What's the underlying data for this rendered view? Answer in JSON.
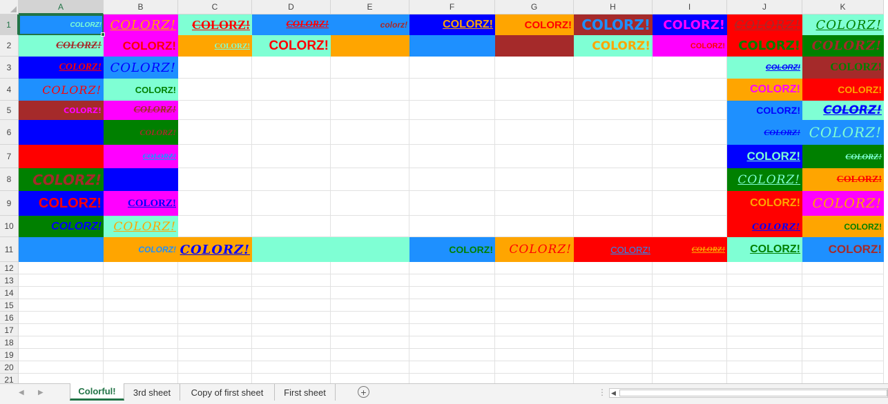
{
  "spreadsheet": {
    "columns": [
      "A",
      "B",
      "C",
      "D",
      "E",
      "F",
      "G",
      "H",
      "I",
      "J",
      "K"
    ],
    "rows": [
      "1",
      "2",
      "3",
      "4",
      "5",
      "6",
      "7",
      "8",
      "9",
      "10",
      "11",
      "12",
      "13",
      "14",
      "15",
      "16",
      "17",
      "18",
      "19",
      "20",
      "21"
    ],
    "selected_cell": "A1",
    "colors": {
      "blue": "#1E90FF",
      "magenta": "#FF00FF",
      "aquamarine": "#7FFFD4",
      "navy": "#0000FF",
      "orange": "#FFA500",
      "brown": "#A52A2A",
      "red": "#FF0000",
      "green": "#008000",
      "header_bg": "#EFEFEF",
      "accent": "#217346",
      "gridline": "#E1E1E1"
    },
    "cells": [
      {
        "ref": "A1",
        "bg": "blue",
        "text": "COLORZ!",
        "color": "aquamarine",
        "font": "arial",
        "size": 10,
        "bold": true,
        "italic": true,
        "under": false,
        "strike": false
      },
      {
        "ref": "B1",
        "bg": "magenta",
        "text": "COLORZ!",
        "color": "orange",
        "font": "script",
        "size": 18,
        "bold": false,
        "italic": true,
        "under": true,
        "strike": false
      },
      {
        "ref": "C1",
        "bg": "aquamarine",
        "text": "COLORZ!",
        "color": "red",
        "font": "serif",
        "size": 18,
        "bold": true,
        "italic": false,
        "under": true,
        "strike": true
      },
      {
        "ref": "D1",
        "bg": "blue",
        "text": "COLORZ!",
        "color": "red",
        "font": "serif",
        "size": 14,
        "bold": true,
        "italic": true,
        "under": true,
        "strike": true
      },
      {
        "ref": "E1",
        "bg": "blue",
        "text": "colorz!",
        "color": "brown",
        "font": "arial",
        "size": 12,
        "bold": true,
        "italic": true,
        "under": false,
        "strike": false
      },
      {
        "ref": "F1",
        "bg": "navy",
        "text": "COLORZ!",
        "color": "orange",
        "font": "arial",
        "size": 16,
        "bold": true,
        "italic": false,
        "under": true,
        "strike": false
      },
      {
        "ref": "G1",
        "bg": "orange",
        "text": "COLORZ!",
        "color": "red",
        "font": "arial",
        "size": 15,
        "bold": true,
        "italic": false,
        "under": false,
        "strike": false
      },
      {
        "ref": "H1",
        "bg": "brown",
        "text": "COLORZ!",
        "color": "blue",
        "font": "impact",
        "size": 20,
        "bold": true,
        "italic": false,
        "under": false,
        "strike": false
      },
      {
        "ref": "I1",
        "bg": "navy",
        "text": "COLORZ!",
        "color": "magenta",
        "font": "impact",
        "size": 18,
        "bold": true,
        "italic": false,
        "under": false,
        "strike": false
      },
      {
        "ref": "J1",
        "bg": "red",
        "text": "COLORZ!",
        "color": "brown",
        "font": "script",
        "size": 18,
        "bold": false,
        "italic": true,
        "under": true,
        "strike": true
      },
      {
        "ref": "K1",
        "bg": "aquamarine",
        "text": "COLORZ!",
        "color": "green",
        "font": "script",
        "size": 18,
        "bold": false,
        "italic": true,
        "under": true,
        "strike": false
      },
      {
        "ref": "A2",
        "bg": "aquamarine",
        "text": "COLORZ!",
        "color": "brown",
        "font": "serif",
        "size": 15,
        "bold": true,
        "italic": true,
        "under": false,
        "strike": true
      },
      {
        "ref": "B2",
        "bg": "magenta",
        "text": "COLORZ!",
        "color": "red",
        "font": "arial",
        "size": 17,
        "bold": true,
        "italic": false,
        "under": false,
        "strike": false
      },
      {
        "ref": "C2",
        "bg": "orange",
        "text": "COLORZ!",
        "color": "aquamarine",
        "font": "serif",
        "size": 11,
        "bold": true,
        "italic": false,
        "under": true,
        "strike": false
      },
      {
        "ref": "D2",
        "bg": "aquamarine",
        "text": "COLORZ!",
        "color": "red",
        "font": "arial",
        "size": 19,
        "bold": true,
        "italic": false,
        "under": false,
        "strike": false
      },
      {
        "ref": "E2",
        "bg": "orange",
        "text": "",
        "color": "",
        "font": "arial",
        "size": 12,
        "bold": false,
        "italic": false,
        "under": false,
        "strike": false
      },
      {
        "ref": "F2",
        "bg": "blue",
        "text": "",
        "color": "",
        "font": "arial",
        "size": 12,
        "bold": false,
        "italic": false,
        "under": false,
        "strike": false
      },
      {
        "ref": "G2",
        "bg": "brown",
        "text": "",
        "color": "",
        "font": "arial",
        "size": 12,
        "bold": false,
        "italic": false,
        "under": false,
        "strike": false
      },
      {
        "ref": "H2",
        "bg": "aquamarine",
        "text": "COLORZ!",
        "color": "orange",
        "font": "impact",
        "size": 17,
        "bold": true,
        "italic": false,
        "under": false,
        "strike": false
      },
      {
        "ref": "I2",
        "bg": "magenta",
        "text": "COLORZ!",
        "color": "red",
        "font": "arial",
        "size": 11,
        "bold": true,
        "italic": false,
        "under": false,
        "strike": false
      },
      {
        "ref": "J2",
        "bg": "red",
        "text": "COLORZ!",
        "color": "green",
        "font": "impact",
        "size": 18,
        "bold": true,
        "italic": false,
        "under": false,
        "strike": false
      },
      {
        "ref": "K2",
        "bg": "green",
        "text": "COLORZ!",
        "color": "brown",
        "font": "script",
        "size": 18,
        "bold": true,
        "italic": true,
        "under": false,
        "strike": false
      },
      {
        "ref": "A3",
        "bg": "navy",
        "text": "COLORZ!",
        "color": "red",
        "font": "serif",
        "size": 14,
        "bold": true,
        "italic": true,
        "under": true,
        "strike": false
      },
      {
        "ref": "B3",
        "bg": "blue",
        "text": "COLORZ!",
        "color": "navy",
        "font": "script",
        "size": 18,
        "bold": false,
        "italic": true,
        "under": false,
        "strike": false
      },
      {
        "ref": "J3",
        "bg": "aquamarine",
        "text": "COLORZ!",
        "color": "navy",
        "font": "arial",
        "size": 11,
        "bold": true,
        "italic": true,
        "under": true,
        "strike": true
      },
      {
        "ref": "K3",
        "bg": "brown",
        "text": "COLORZ!",
        "color": "green",
        "font": "serif",
        "size": 16,
        "bold": true,
        "italic": false,
        "under": false,
        "strike": false
      },
      {
        "ref": "A4",
        "bg": "blue",
        "text": "COLORZ!",
        "color": "red",
        "font": "script",
        "size": 16,
        "bold": false,
        "italic": true,
        "under": false,
        "strike": false
      },
      {
        "ref": "B4",
        "bg": "aquamarine",
        "text": "COLORZ!",
        "color": "green",
        "font": "arial",
        "size": 13,
        "bold": true,
        "italic": false,
        "under": false,
        "strike": false
      },
      {
        "ref": "J4",
        "bg": "orange",
        "text": "COLORZ!",
        "color": "magenta",
        "font": "arial",
        "size": 16,
        "bold": true,
        "italic": false,
        "under": false,
        "strike": false
      },
      {
        "ref": "K4",
        "bg": "red",
        "text": "COLORZ!",
        "color": "orange",
        "font": "arial",
        "size": 14,
        "bold": true,
        "italic": false,
        "under": false,
        "strike": false
      },
      {
        "ref": "A5",
        "bg": "brown",
        "text": "COLORZ!",
        "color": "magenta",
        "font": "impact",
        "size": 11,
        "bold": true,
        "italic": false,
        "under": false,
        "strike": false
      },
      {
        "ref": "B5",
        "bg": "magenta",
        "text": "COLORZ!",
        "color": "brown",
        "font": "serif",
        "size": 14,
        "bold": true,
        "italic": true,
        "under": false,
        "strike": true
      },
      {
        "ref": "J5",
        "bg": "blue",
        "text": "COLORZ!",
        "color": "navy",
        "font": "arial",
        "size": 14,
        "bold": true,
        "italic": false,
        "under": false,
        "strike": false
      },
      {
        "ref": "K5",
        "bg": "aquamarine",
        "text": "COLORZ!",
        "color": "navy",
        "font": "impact",
        "size": 17,
        "bold": true,
        "italic": true,
        "under": true,
        "strike": true
      },
      {
        "ref": "A6",
        "bg": "navy",
        "text": "",
        "color": "",
        "font": "arial",
        "size": 12,
        "bold": false,
        "italic": false,
        "under": false,
        "strike": false
      },
      {
        "ref": "B6",
        "bg": "green",
        "text": "COLORZ!",
        "color": "brown",
        "font": "serif",
        "size": 12,
        "bold": true,
        "italic": true,
        "under": false,
        "strike": false
      },
      {
        "ref": "J6",
        "bg": "blue",
        "text": "COLORZ!",
        "color": "navy",
        "font": "serif",
        "size": 12,
        "bold": true,
        "italic": true,
        "under": false,
        "strike": true
      },
      {
        "ref": "K6",
        "bg": "blue",
        "text": "COLORZ!",
        "color": "aquamarine",
        "font": "script",
        "size": 20,
        "bold": false,
        "italic": true,
        "under": false,
        "strike": false
      },
      {
        "ref": "A7",
        "bg": "red",
        "text": "",
        "color": "",
        "font": "arial",
        "size": 12,
        "bold": false,
        "italic": false,
        "under": false,
        "strike": false
      },
      {
        "ref": "B7",
        "bg": "magenta",
        "text": "COLORZ!",
        "color": "blue",
        "font": "serif",
        "size": 11,
        "bold": true,
        "italic": true,
        "under": true,
        "strike": true
      },
      {
        "ref": "J7",
        "bg": "navy",
        "text": "COLORZ!",
        "color": "aquamarine",
        "font": "arial",
        "size": 17,
        "bold": true,
        "italic": false,
        "under": true,
        "strike": false
      },
      {
        "ref": "K7",
        "bg": "green",
        "text": "COLORZ!",
        "color": "aquamarine",
        "font": "serif",
        "size": 12,
        "bold": true,
        "italic": true,
        "under": false,
        "strike": true
      },
      {
        "ref": "A8",
        "bg": "green",
        "text": "COLORZ!",
        "color": "brown",
        "font": "impact",
        "size": 20,
        "bold": true,
        "italic": true,
        "under": false,
        "strike": false
      },
      {
        "ref": "B8",
        "bg": "navy",
        "text": "",
        "color": "",
        "font": "arial",
        "size": 12,
        "bold": false,
        "italic": false,
        "under": false,
        "strike": false
      },
      {
        "ref": "J8",
        "bg": "green",
        "text": "COLORZ!",
        "color": "aquamarine",
        "font": "script",
        "size": 17,
        "bold": false,
        "italic": true,
        "under": true,
        "strike": false
      },
      {
        "ref": "K8",
        "bg": "orange",
        "text": "COLORZ!",
        "color": "red",
        "font": "serif",
        "size": 14,
        "bold": true,
        "italic": false,
        "under": false,
        "strike": true
      },
      {
        "ref": "A9",
        "bg": "navy",
        "text": "COLORZ!",
        "color": "red",
        "font": "arial",
        "size": 20,
        "bold": true,
        "italic": false,
        "under": false,
        "strike": false
      },
      {
        "ref": "B9",
        "bg": "magenta",
        "text": "COLORZ!",
        "color": "navy",
        "font": "serif",
        "size": 15,
        "bold": true,
        "italic": false,
        "under": true,
        "strike": false
      },
      {
        "ref": "J9",
        "bg": "red",
        "text": "COLORZ!",
        "color": "orange",
        "font": "arial",
        "size": 16,
        "bold": true,
        "italic": false,
        "under": false,
        "strike": false
      },
      {
        "ref": "K9",
        "bg": "magenta",
        "text": "COLORZ!",
        "color": "orange",
        "font": "script",
        "size": 19,
        "bold": false,
        "italic": true,
        "under": false,
        "strike": false
      },
      {
        "ref": "A10",
        "bg": "green",
        "text": "COLORZ!",
        "color": "navy",
        "font": "arial",
        "size": 16,
        "bold": true,
        "italic": true,
        "under": false,
        "strike": false
      },
      {
        "ref": "B10",
        "bg": "aquamarine",
        "text": "COLORZ!",
        "color": "orange",
        "font": "script",
        "size": 17,
        "bold": false,
        "italic": true,
        "under": true,
        "strike": false
      },
      {
        "ref": "J10",
        "bg": "red",
        "text": "COLORZ!",
        "color": "navy",
        "font": "script",
        "size": 12,
        "bold": true,
        "italic": true,
        "under": true,
        "strike": false
      },
      {
        "ref": "K10",
        "bg": "orange",
        "text": "COLORZ!",
        "color": "green",
        "font": "arial",
        "size": 12,
        "bold": true,
        "italic": false,
        "under": false,
        "strike": false
      },
      {
        "ref": "A11",
        "bg": "blue",
        "text": "",
        "color": "",
        "font": "arial",
        "size": 12,
        "bold": false,
        "italic": false,
        "under": false,
        "strike": false
      },
      {
        "ref": "B11",
        "bg": "orange",
        "text": "COLORZ!",
        "color": "blue",
        "font": "arial",
        "size": 12,
        "bold": true,
        "italic": true,
        "under": false,
        "strike": false
      },
      {
        "ref": "C11",
        "bg": "orange",
        "text": "COLORZ!",
        "color": "navy",
        "font": "script",
        "size": 18,
        "bold": true,
        "italic": true,
        "under": true,
        "strike": false
      },
      {
        "ref": "D11",
        "bg": "aquamarine",
        "text": "",
        "color": "",
        "font": "arial",
        "size": 12,
        "bold": false,
        "italic": false,
        "under": false,
        "strike": false
      },
      {
        "ref": "E11",
        "bg": "aquamarine",
        "text": "",
        "color": "",
        "font": "arial",
        "size": 12,
        "bold": false,
        "italic": false,
        "under": false,
        "strike": false
      },
      {
        "ref": "F11",
        "bg": "blue",
        "text": "COLORZ!",
        "color": "green",
        "font": "arial",
        "size": 14,
        "bold": true,
        "italic": false,
        "under": false,
        "strike": false
      },
      {
        "ref": "G11",
        "bg": "orange",
        "text": "COLORZ!",
        "color": "red",
        "font": "script",
        "size": 17,
        "bold": false,
        "italic": true,
        "under": false,
        "strike": false
      },
      {
        "ref": "H11",
        "bg": "red",
        "text": "COLORZ!",
        "color": "blue",
        "font": "arial",
        "size": 13,
        "bold": false,
        "italic": false,
        "under": true,
        "strike": false
      },
      {
        "ref": "I11",
        "bg": "red",
        "text": "COLORZ!",
        "color": "orange",
        "font": "serif",
        "size": 11,
        "bold": true,
        "italic": true,
        "under": true,
        "strike": true
      },
      {
        "ref": "J11",
        "bg": "aquamarine",
        "text": "COLORZ!",
        "color": "green",
        "font": "arial",
        "size": 16,
        "bold": true,
        "italic": false,
        "under": true,
        "strike": false
      },
      {
        "ref": "K11",
        "bg": "blue",
        "text": "COLORZ!",
        "color": "brown",
        "font": "arial",
        "size": 17,
        "bold": true,
        "italic": false,
        "under": false,
        "strike": false
      }
    ]
  },
  "tabs": {
    "items": [
      {
        "label": "Colorful!",
        "active": true
      },
      {
        "label": "3rd sheet",
        "active": false
      },
      {
        "label": "Copy of first sheet",
        "active": false
      },
      {
        "label": "First sheet",
        "active": false
      }
    ],
    "add_sheet_icon": "plus-circle-icon",
    "prev_icon": "triangle-left-icon",
    "next_icon": "triangle-right-icon"
  }
}
